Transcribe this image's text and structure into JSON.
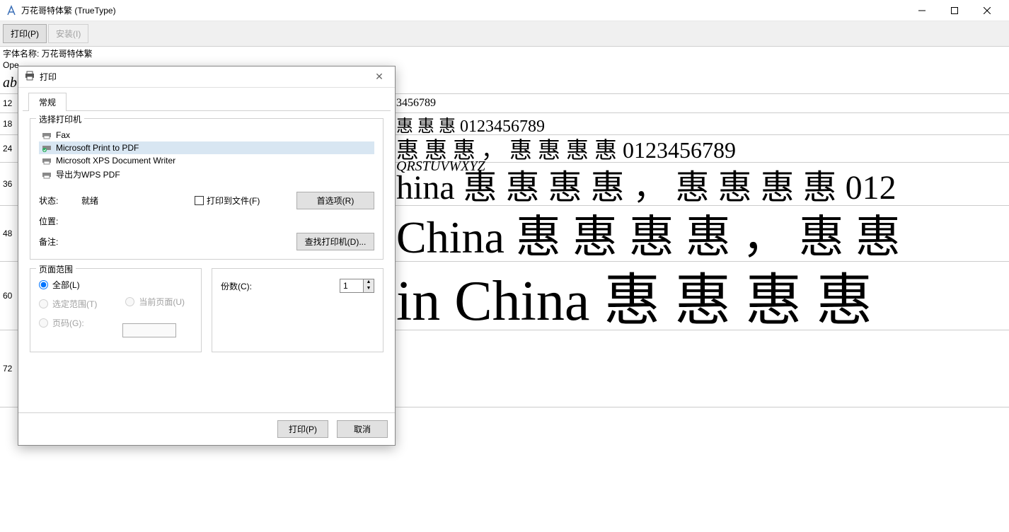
{
  "window": {
    "title": "万花哥特体繁 (TrueType)"
  },
  "toolbar": {
    "print_label": "打印(P)",
    "install_label": "安装(I)"
  },
  "info": {
    "font_name_label": "字体名称: 万花哥特体繁",
    "opentype_label": "Ope"
  },
  "samples": {
    "uppercase": "QRSTUVWXYZ",
    "lowercase_truncated": "ab",
    "rows": [
      {
        "pt": "12",
        "text": "3456789"
      },
      {
        "pt": "18",
        "text": "惠 惠 惠  0123456789"
      },
      {
        "pt": "24",
        "text": "惠 惠 惠 ， 惠 惠 惠 惠  0123456789"
      },
      {
        "pt": "36",
        "text": "hina 惠 惠 惠 惠 ， 惠 惠 惠 惠  012"
      },
      {
        "pt": "48",
        "text": "China 惠 惠 惠 惠 ， 惠 惠"
      },
      {
        "pt": "60",
        "text": "in China 惠 惠 惠 惠"
      },
      {
        "pt": "72",
        "text": ""
      }
    ]
  },
  "print_dialog": {
    "title": "打印",
    "tab_general": "常规",
    "group_printer": "选择打印机",
    "printers": [
      {
        "name": "Fax",
        "selected": false
      },
      {
        "name": "Microsoft Print to PDF",
        "selected": true
      },
      {
        "name": "Microsoft XPS Document Writer",
        "selected": false
      },
      {
        "name": "导出为WPS PDF",
        "selected": false
      }
    ],
    "status_label": "状态:",
    "status_value": "就绪",
    "location_label": "位置:",
    "comment_label": "备注:",
    "print_to_file_label": "打印到文件(F)",
    "preferences_label": "首选项(R)",
    "find_printer_label": "查找打印机(D)...",
    "page_range_legend": "页面范围",
    "radio_all": "全部(L)",
    "radio_selection": "选定范围(T)",
    "radio_current": "当前页面(U)",
    "radio_pages": "页码(G):",
    "copies_label": "份数(C):",
    "copies_value": "1",
    "btn_print": "打印(P)",
    "btn_cancel": "取消"
  }
}
